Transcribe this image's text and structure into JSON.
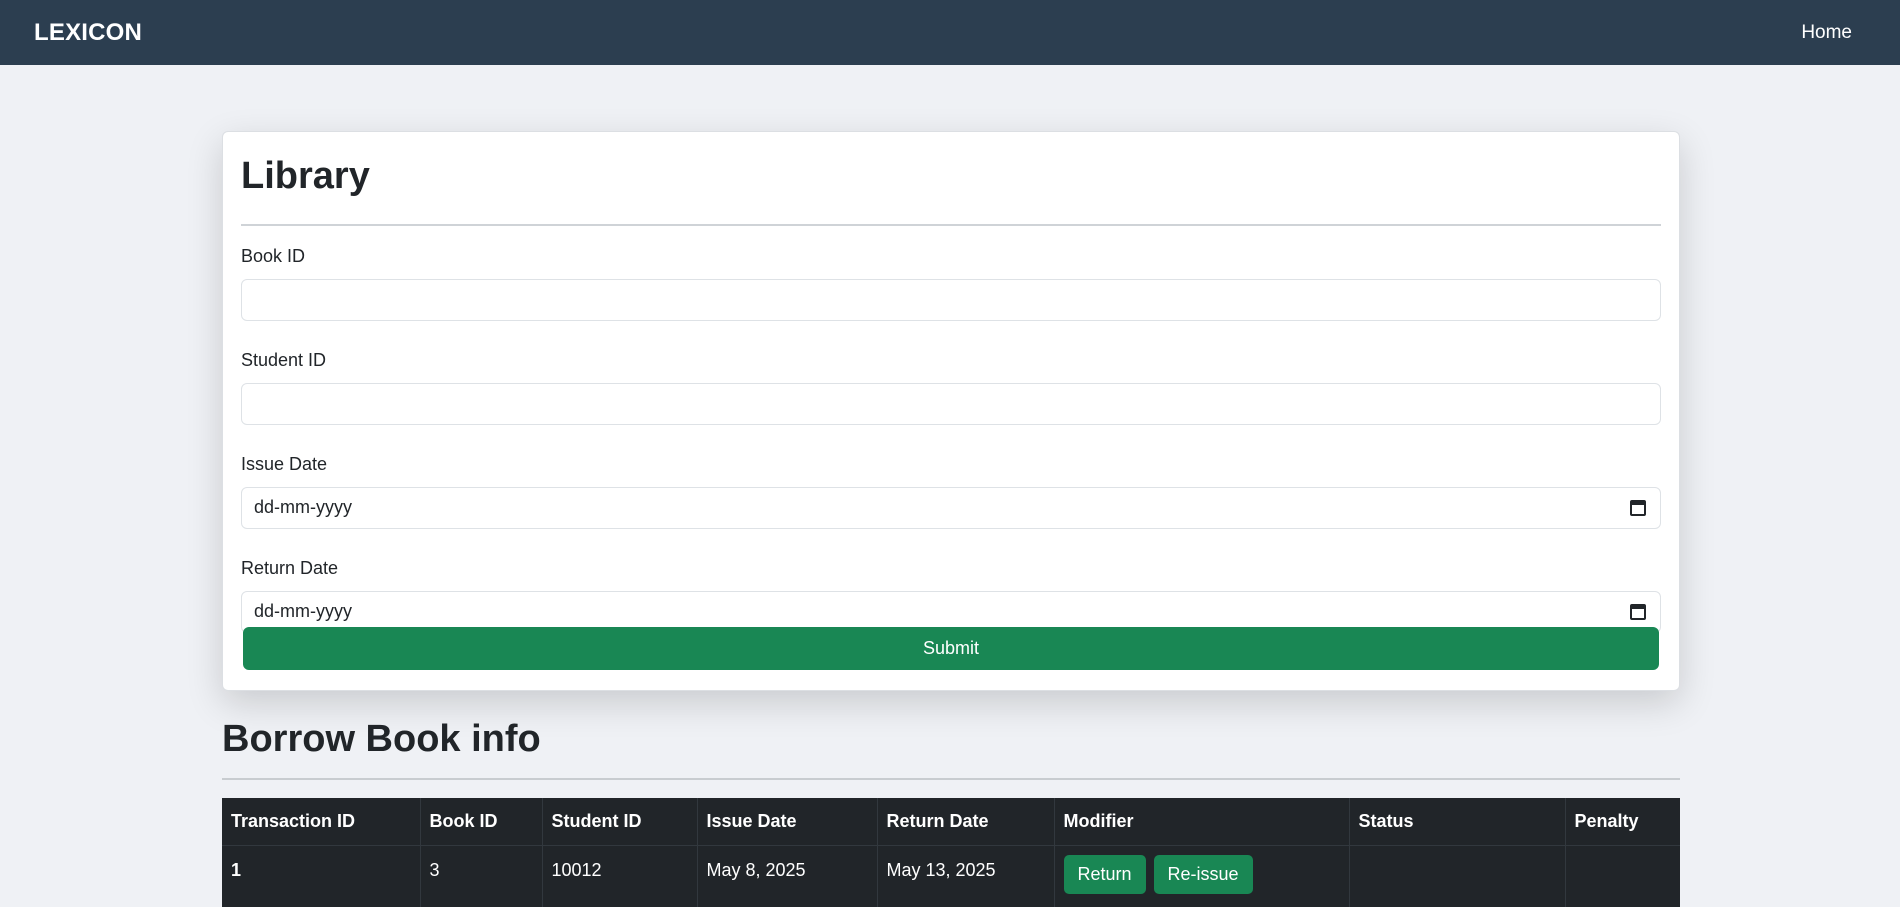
{
  "navbar": {
    "brand": "LEXICON",
    "home": "Home"
  },
  "form": {
    "title": "Library",
    "fields": [
      {
        "label": "Book ID",
        "value": ""
      },
      {
        "label": "Student ID",
        "value": ""
      },
      {
        "label": "Issue Date",
        "placeholder": "dd-mm-yyyy"
      },
      {
        "label": "Return Date",
        "placeholder": "dd-mm-yyyy"
      }
    ],
    "submit_label": "Submit"
  },
  "borrow": {
    "title": "Borrow Book info",
    "columns": [
      "Transaction ID",
      "Book ID",
      "Student ID",
      "Issue Date",
      "Return Date",
      "Modifier",
      "Status",
      "Penalty"
    ],
    "rows": [
      {
        "transaction_id": "1",
        "book_id": "3",
        "student_id": "10012",
        "issue_date": "May 8, 2025",
        "return_date": "May 13, 2025",
        "return_label": "Return",
        "reissue_label": "Re-issue",
        "status": "",
        "penalty": ""
      }
    ]
  },
  "colors": {
    "navbar": "#2c3e50",
    "accent_green": "#198754",
    "table_dark": "#212529",
    "page_bg": "#eff1f5"
  },
  "icons": {
    "date_picker": "calendar-icon"
  }
}
